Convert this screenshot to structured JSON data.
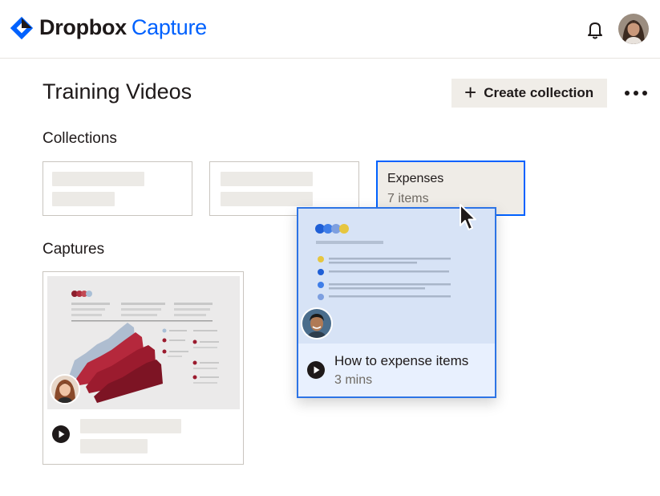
{
  "header": {
    "brand_primary": "Dropbox",
    "brand_secondary": "Capture",
    "brand_color": "#0061fe",
    "notification_icon": "bell-icon",
    "avatar_icon": "user-avatar"
  },
  "page": {
    "title": "Training Videos",
    "create_label": "Create collection",
    "create_icon": "plus-icon",
    "more_icon": "more-horizontal-icon"
  },
  "collections": {
    "label": "Collections",
    "items": [
      {
        "title": "Expenses",
        "subtitle": "7 items"
      }
    ]
  },
  "captures": {
    "label": "Captures"
  },
  "dragged_capture": {
    "title": "How to expense items",
    "subtitle": "3 mins",
    "play_icon": "play-icon",
    "accent": "#2d74e5"
  }
}
